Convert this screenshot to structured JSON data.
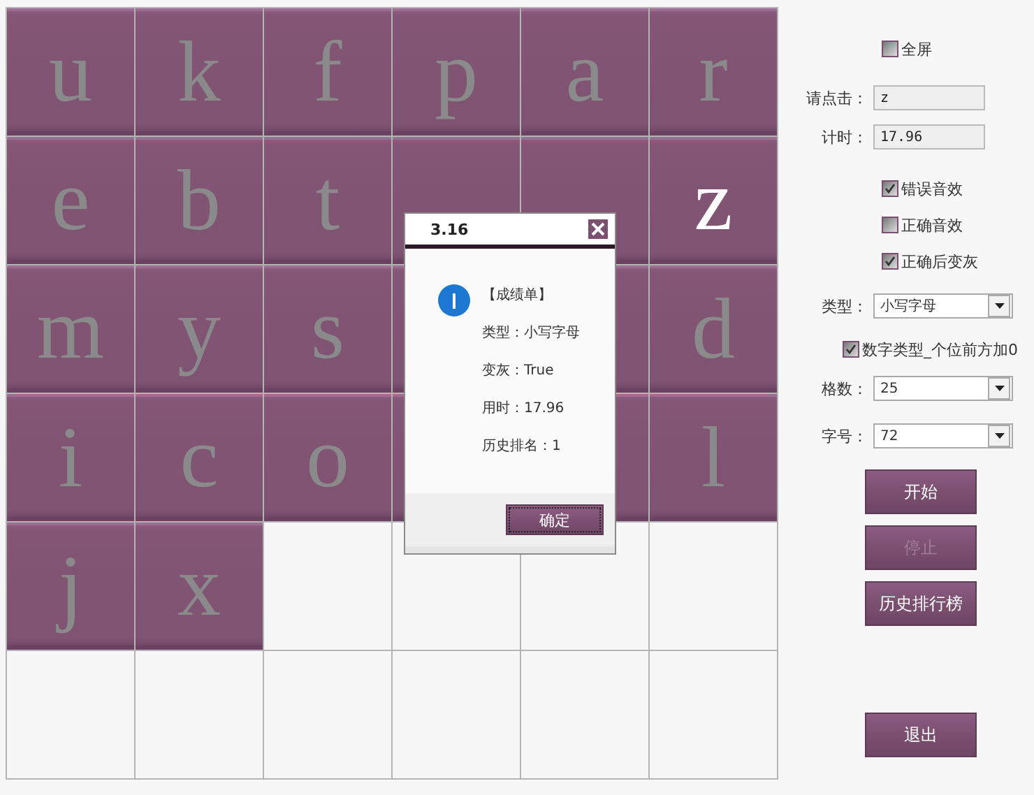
{
  "grid": {
    "rows": [
      [
        {
          "kind": "tile",
          "letter": "u",
          "grayed": true
        },
        {
          "kind": "tile",
          "letter": "k",
          "grayed": true
        },
        {
          "kind": "tile",
          "letter": "f",
          "grayed": true
        },
        {
          "kind": "tile",
          "letter": "p",
          "grayed": true
        },
        {
          "kind": "tile",
          "letter": "a",
          "grayed": true
        },
        {
          "kind": "tile",
          "letter": "r",
          "grayed": true
        }
      ],
      [
        {
          "kind": "tile",
          "letter": "e",
          "grayed": true
        },
        {
          "kind": "tile",
          "letter": "b",
          "grayed": true
        },
        {
          "kind": "tile",
          "letter": "t",
          "grayed": true
        },
        {
          "kind": "tile"
        },
        {
          "kind": "tile"
        },
        {
          "kind": "tile",
          "letter": "z",
          "grayed": false
        }
      ],
      [
        {
          "kind": "tile",
          "letter": "m",
          "grayed": true
        },
        {
          "kind": "tile",
          "letter": "y",
          "grayed": true
        },
        {
          "kind": "tile",
          "letter": "s",
          "grayed": true
        },
        {
          "kind": "tile"
        },
        {
          "kind": "tile"
        },
        {
          "kind": "tile",
          "letter": "d",
          "grayed": true
        }
      ],
      [
        {
          "kind": "tile",
          "letter": "i",
          "grayed": true
        },
        {
          "kind": "tile",
          "letter": "c",
          "grayed": true
        },
        {
          "kind": "tile",
          "letter": "o",
          "grayed": true
        },
        {
          "kind": "tile"
        },
        {
          "kind": "tile"
        },
        {
          "kind": "tile",
          "letter": "l",
          "grayed": true
        }
      ],
      [
        {
          "kind": "tile",
          "letter": "j",
          "grayed": true
        },
        {
          "kind": "tile",
          "letter": "x",
          "grayed": true
        },
        {
          "kind": "empty"
        },
        {
          "kind": "empty"
        },
        {
          "kind": "empty"
        },
        {
          "kind": "empty"
        }
      ],
      [
        {
          "kind": "empty"
        },
        {
          "kind": "empty"
        },
        {
          "kind": "empty"
        },
        {
          "kind": "empty"
        },
        {
          "kind": "empty"
        },
        {
          "kind": "empty"
        }
      ]
    ]
  },
  "dialog": {
    "title": "3.16",
    "lines": [
      "【成绩单】",
      "类型：小写字母",
      "变灰：True",
      "用时：17.96",
      "历史排名：1"
    ],
    "ok_button": "确定"
  },
  "panel": {
    "fullscreen": {
      "label": "全屏",
      "checked": false
    },
    "fields": [
      {
        "label": "请点击：",
        "value": "z"
      },
      {
        "label": "计时：",
        "value": "17.96"
      }
    ],
    "options": [
      {
        "label": "错误音效",
        "checked": true
      },
      {
        "label": "正确音效",
        "checked": false
      },
      {
        "label": "正确后变灰",
        "checked": true
      }
    ],
    "type_select": {
      "label": "类型：",
      "value": "小写字母"
    },
    "zero_pad": {
      "label": "数字类型_个位前方加0",
      "checked": true
    },
    "selects": [
      {
        "label": "格数：",
        "value": "25"
      },
      {
        "label": "字号：",
        "value": "72"
      }
    ],
    "buttons": [
      {
        "label": "开始",
        "disabled": false
      },
      {
        "label": "停止",
        "disabled": true
      },
      {
        "label": "历史排行榜",
        "disabled": false
      }
    ],
    "exit_button": "退出"
  }
}
